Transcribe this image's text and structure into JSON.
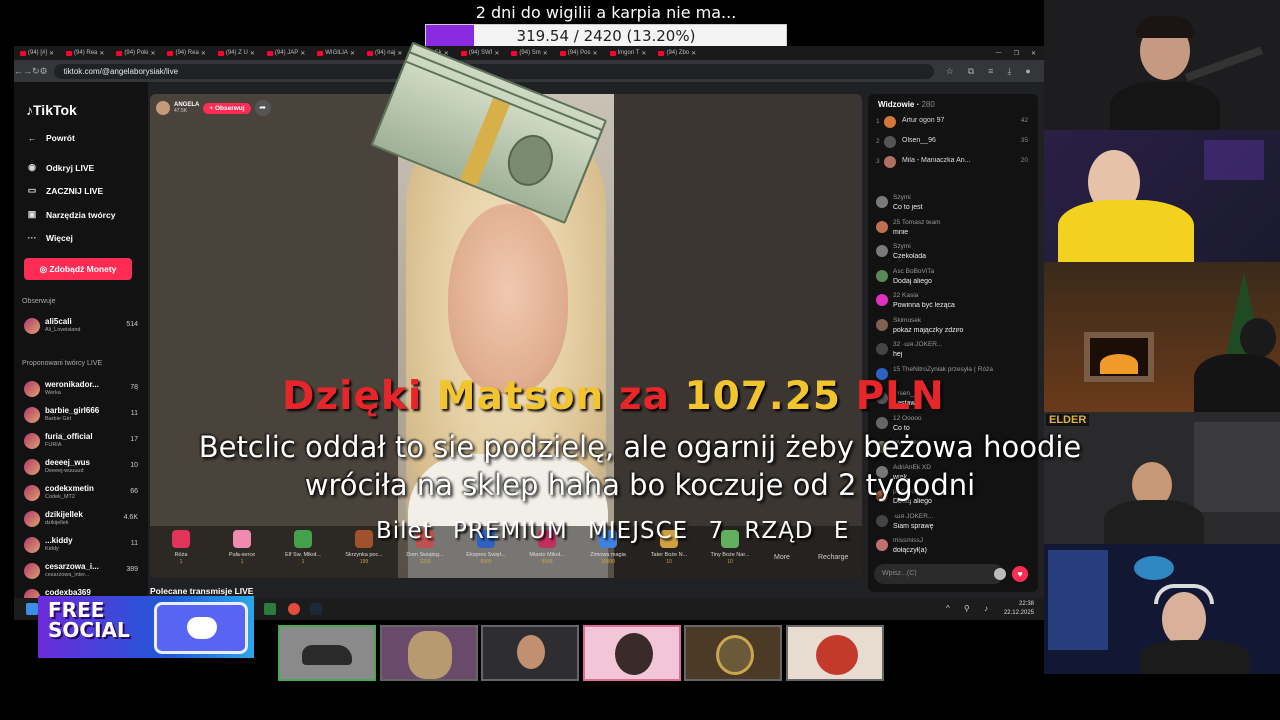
{
  "goal": {
    "title": "2 dni do wigilii a karpia nie ma...",
    "progress_text": "319.54 / 2420 (13.20%)",
    "progress_fraction": 0.132,
    "fill_color": "#8a2be2"
  },
  "browser": {
    "tabs": [
      "(94) [#]",
      "(94) Rea",
      "(94) Poki",
      "(94) Rea",
      "(94) Z U",
      "(94) JAP",
      "WIGILIA",
      "(94) naj",
      "(94) Sk",
      "(94) SWI",
      "(94) Sm",
      "(94) Pos",
      "Imgon T",
      "(94) Zbo"
    ],
    "url": "tiktok.com/@angelaborysiak/live",
    "window_controls": [
      "—",
      "❐",
      "✕"
    ]
  },
  "tiktok": {
    "logo": "TikTok",
    "menu": [
      {
        "label": "Powrót",
        "icon": "back-arrow-icon"
      },
      {
        "label": "Odkryj LIVE",
        "icon": "live-icon"
      },
      {
        "label": "ZACZNIJ LIVE",
        "icon": "camera-icon"
      },
      {
        "label": "Narzędzia twórcy",
        "icon": "tools-icon"
      },
      {
        "label": "Więcej",
        "icon": "more-icon"
      }
    ],
    "coins_button": "Zdobądź Monety",
    "followed_section": "Obserwuje",
    "followed": [
      {
        "name": "ali5cali",
        "sub": "Ali_Loveisland",
        "count": "514"
      }
    ],
    "suggested_section": "Proponowani twórcy LIVE",
    "suggested": [
      {
        "name": "weronikador...",
        "sub": "Werka",
        "count": "78"
      },
      {
        "name": "barbie_girl666",
        "sub": "Barbie Girl",
        "count": "11"
      },
      {
        "name": "furia_official",
        "sub": "FURIA",
        "count": "17"
      },
      {
        "name": "deeeej_wus",
        "sub": "Deeeej-wuuuud",
        "count": "10"
      },
      {
        "name": "codekxmetin",
        "sub": "Codek_MT2",
        "count": "66"
      },
      {
        "name": "dzikijellek",
        "sub": "dzikijellek",
        "count": "4.6K"
      },
      {
        "name": "...kiddy",
        "sub": "Kiddy",
        "count": "11"
      },
      {
        "name": "cesarzowa_i...",
        "sub": "cesarzowa_inter...",
        "count": "389"
      },
      {
        "name": "codexba369",
        "sub": "",
        "count": ""
      }
    ],
    "polecane": "Polecane transmisje LIVE"
  },
  "stream": {
    "host": "ANGELA",
    "likes": "47.5K",
    "follow_label": "+ Obserwuj",
    "gifts": [
      {
        "name": "Róża",
        "price": "1",
        "color": "#e0345a"
      },
      {
        "name": "Puła-serce",
        "price": "1",
        "color": "#f08ab0"
      },
      {
        "name": "Elf Św. Mikoł...",
        "price": "1",
        "color": "#44a04a"
      },
      {
        "name": "Skrzynka poc...",
        "price": "199",
        "color": "#a0522d"
      },
      {
        "name": "Dom Świąteg...",
        "price": "2200",
        "color": "#c05050"
      },
      {
        "name": "Ekspres Święt...",
        "price": "5999",
        "color": "#3060c0"
      },
      {
        "name": "Miasto Mikoł...",
        "price": "9999",
        "color": "#c03060"
      },
      {
        "name": "Zimowa magia",
        "price": "19999",
        "color": "#4080e0"
      },
      {
        "name": "Tater Boże N...",
        "price": "10",
        "color": "#d0a040"
      },
      {
        "name": "Tiny Boże Nar...",
        "price": "10",
        "color": "#60b060"
      }
    ],
    "more_label": "More",
    "recharge_label": "Recharge"
  },
  "chat": {
    "viewers_label": "Widzowie",
    "viewers_count": "280",
    "top_viewers": [
      {
        "rank": "1",
        "name": "Artur ogon 97",
        "score": "42",
        "color": "#d4783a"
      },
      {
        "rank": "2",
        "name": "Olsen__96",
        "score": "35",
        "color": "#555"
      },
      {
        "rank": "3",
        "name": "Mila - Maniaczka An...",
        "score": "20",
        "color": "#b07060"
      }
    ],
    "messages": [
      {
        "user": "Szymi",
        "text": "Co to jest",
        "color": "#7a7a7a"
      },
      {
        "user": "25 Tomasz team",
        "text": "mnie",
        "color": "#c07050"
      },
      {
        "user": "Szymi",
        "text": "Czekolada",
        "color": "#7a7a7a"
      },
      {
        "user": "Asc BoBoViTa",
        "text": "Dodaj aliego",
        "color": "#5a8a5a"
      },
      {
        "user": "22 Kasia",
        "text": "Powinna być leżąca",
        "color": "#e030c0"
      },
      {
        "user": "Skimosek",
        "text": "pokaż majączky zdziro",
        "color": "#806050"
      },
      {
        "user": "32 ·ɯᴙ·JOKER...",
        "text": "hej",
        "color": "#444"
      },
      {
        "user": "15 TheNitroZyniak przesyła ( Róża",
        "text": "",
        "color": "#3060c0"
      },
      {
        "user": "Olsen__96",
        "text": "Zestaw",
        "color": "#555"
      },
      {
        "user": "12 Ooooo",
        "text": "Co to",
        "color": "#666"
      },
      {
        "user": "jovelasand",
        "text": "",
        "color": "#886"
      },
      {
        "user": "AdriAnEk XD",
        "text": "wiek",
        "color": "#777"
      },
      {
        "user": "piscaso",
        "text": "Dodaj aliego",
        "color": "#a06040"
      },
      {
        "user": "·ɯᴙ·JOKER...",
        "text": "Siam sprawę",
        "color": "#444"
      },
      {
        "user": "missmissJ",
        "text": "dołączył(a)",
        "color": "#c07070"
      }
    ],
    "input_placeholder": "Wpisz...(C)"
  },
  "overlay": {
    "donation_prefix": "Dzięki",
    "donation_name": "Matson",
    "donation_mid": "za",
    "donation_amount": "107.25",
    "donation_currency": "PLN",
    "message_line1": "Betclic oddał to sie podzielę, ale ogarnij żeby beżowa hoodie",
    "message_line2": "wróciła na sklep haha bo koczuje od 2 tygodni",
    "ticket": "Bilet PREMIUM MIEJSCE 7 RZĄD E",
    "free_social": "FREE SOCIAL",
    "elder_tag": "ELDER"
  },
  "taskbar": {
    "time": "22:38",
    "date": "22.12.2025"
  }
}
